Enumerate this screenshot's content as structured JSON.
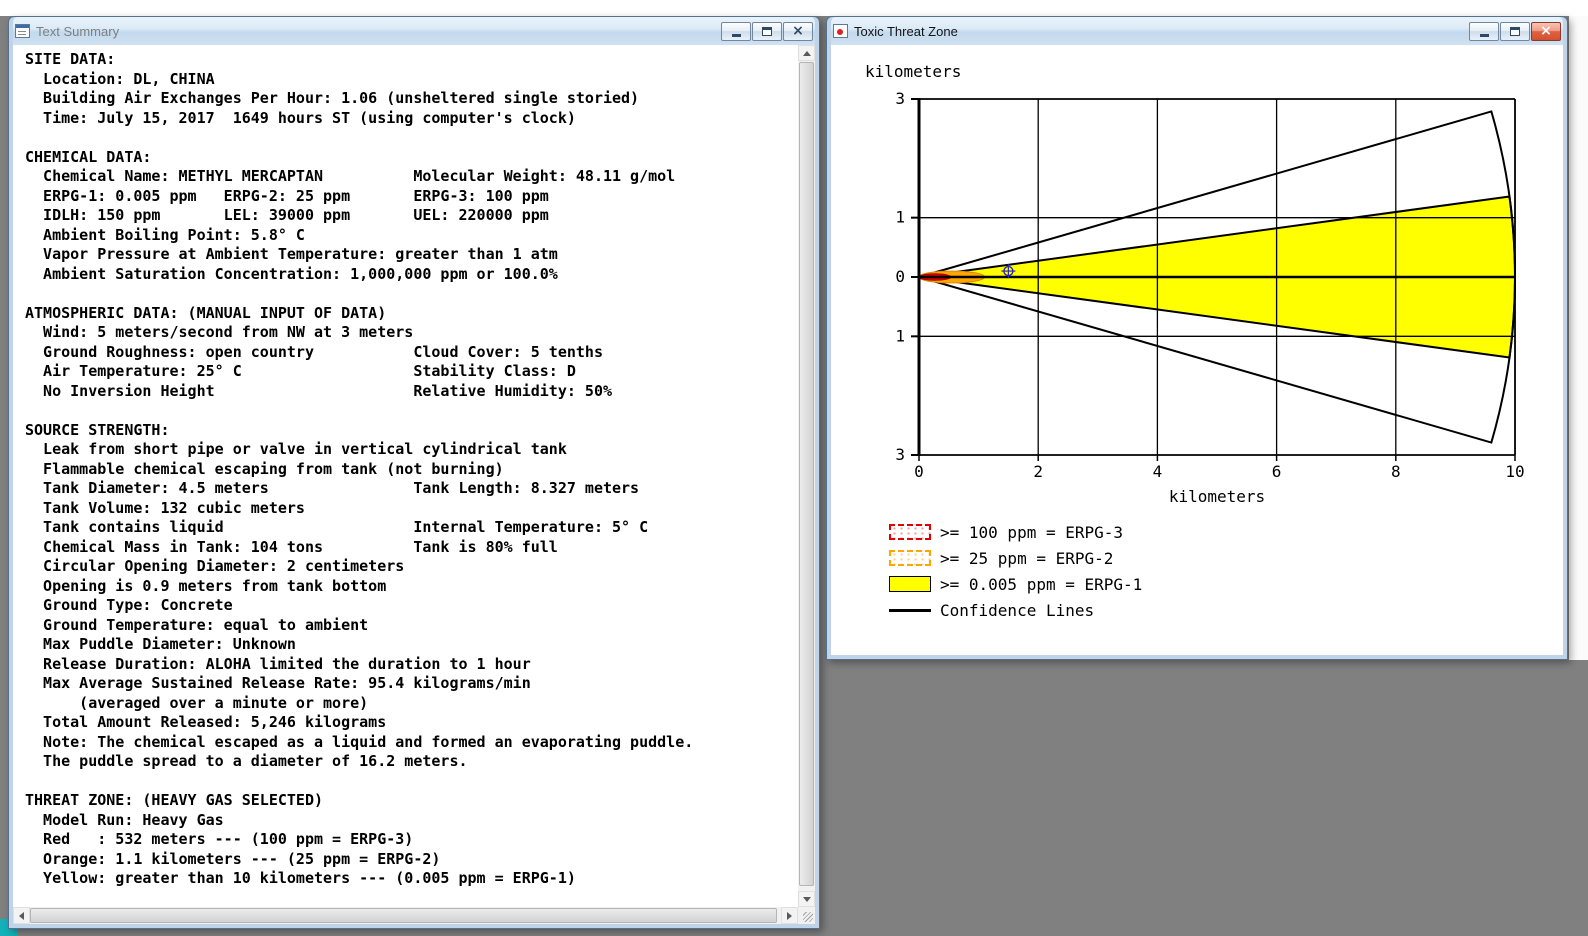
{
  "desktop": {
    "background": "#808080",
    "top_strip": "#ffffff"
  },
  "icons": {
    "close_glyph": "×"
  },
  "text_summary_window": {
    "title": "Text Summary",
    "lines": [
      "SITE DATA:",
      "  Location: DL, CHINA",
      "  Building Air Exchanges Per Hour: 1.06 (unsheltered single storied)",
      "  Time: July 15, 2017  1649 hours ST (using computer's clock)",
      "",
      "CHEMICAL DATA:",
      "  Chemical Name: METHYL MERCAPTAN          Molecular Weight: 48.11 g/mol",
      "  ERPG-1: 0.005 ppm   ERPG-2: 25 ppm       ERPG-3: 100 ppm",
      "  IDLH: 150 ppm       LEL: 39000 ppm       UEL: 220000 ppm",
      "  Ambient Boiling Point: 5.8° C",
      "  Vapor Pressure at Ambient Temperature: greater than 1 atm",
      "  Ambient Saturation Concentration: 1,000,000 ppm or 100.0%",
      "",
      "ATMOSPHERIC DATA: (MANUAL INPUT OF DATA)",
      "  Wind: 5 meters/second from NW at 3 meters",
      "  Ground Roughness: open country           Cloud Cover: 5 tenths",
      "  Air Temperature: 25° C                   Stability Class: D",
      "  No Inversion Height                      Relative Humidity: 50%",
      "",
      "SOURCE STRENGTH:",
      "  Leak from short pipe or valve in vertical cylindrical tank",
      "  Flammable chemical escaping from tank (not burning)",
      "  Tank Diameter: 4.5 meters                Tank Length: 8.327 meters",
      "  Tank Volume: 132 cubic meters",
      "  Tank contains liquid                     Internal Temperature: 5° C",
      "  Chemical Mass in Tank: 104 tons          Tank is 80% full",
      "  Circular Opening Diameter: 2 centimeters",
      "  Opening is 0.9 meters from tank bottom",
      "  Ground Type: Concrete",
      "  Ground Temperature: equal to ambient",
      "  Max Puddle Diameter: Unknown",
      "  Release Duration: ALOHA limited the duration to 1 hour",
      "  Max Average Sustained Release Rate: 95.4 kilograms/min",
      "      (averaged over a minute or more)",
      "  Total Amount Released: 5,246 kilograms",
      "  Note: The chemical escaped as a liquid and formed an evaporating puddle.",
      "  The puddle spread to a diameter of 16.2 meters.",
      "",
      "THREAT ZONE: (HEAVY GAS SELECTED)",
      "  Model Run: Heavy Gas",
      "  Red   : 532 meters --- (100 ppm = ERPG-3)",
      "  Orange: 1.1 kilometers --- (25 ppm = ERPG-2)",
      "  Yellow: greater than 10 kilometers --- (0.005 ppm = ERPG-1)"
    ]
  },
  "threat_zone_window": {
    "title": "Toxic Threat Zone"
  },
  "chart_data": {
    "type": "area",
    "title": "Toxic Threat Zone",
    "xlabel": "kilometers",
    "ylabel": "kilometers",
    "xlim": [
      0,
      10
    ],
    "ylim": [
      -3,
      3
    ],
    "xticks": [
      0,
      2,
      4,
      6,
      8,
      10
    ],
    "xtick_labels": [
      "0",
      "2",
      "4",
      "6",
      "8",
      "10"
    ],
    "yticks": [
      3,
      1,
      0,
      -1,
      -3
    ],
    "ytick_labels": [
      "3",
      "1",
      "0",
      "1",
      "3"
    ],
    "grid": true,
    "zones": [
      {
        "name": "ERPG-1",
        "threshold": ">= 0.005 ppm",
        "color": "#ffff00",
        "shape": "sector",
        "extent_km": 10,
        "half_angle_deg": 7.8,
        "outline": "#000000",
        "note": "greater than 10 kilometers"
      },
      {
        "name": "ERPG-2",
        "threshold": ">= 25 ppm",
        "color": "#ffa500",
        "shape": "ellipse",
        "extent_km": 1.1,
        "half_width_km": 0.1,
        "outline": "#d98c00"
      },
      {
        "name": "ERPG-3",
        "threshold": ">= 100 ppm",
        "color": "#dd0000",
        "shape": "ellipse",
        "extent_km": 0.532,
        "half_width_km": 0.055,
        "outline": "#aa0000"
      }
    ],
    "confidence_lines": {
      "label": "Confidence Lines",
      "shape": "sector",
      "extent_km": 10,
      "half_angle_deg": 16.2,
      "color": "#000000"
    },
    "centerline": {
      "y": 0,
      "color": "#000000"
    },
    "marker": {
      "x": 1.5,
      "y": 0.1,
      "color": "#2a2ab0",
      "symbol": "circle-cross"
    },
    "legend": [
      {
        "swatch": "red-dashed",
        "label": ">= 100 ppm = ERPG-3"
      },
      {
        "swatch": "orange-dashed",
        "label": ">= 25 ppm = ERPG-2"
      },
      {
        "swatch": "yellow-solid",
        "label": ">= 0.005 ppm = ERPG-1"
      },
      {
        "swatch": "line",
        "label": "Confidence Lines"
      }
    ],
    "legend_position": "bottom-left"
  }
}
